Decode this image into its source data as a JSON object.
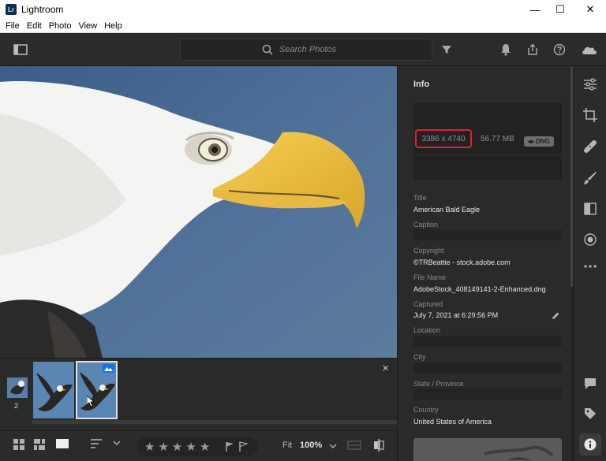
{
  "window": {
    "app_icon_text": "Lr",
    "title": "Lightroom",
    "minimize": "—",
    "maximize": "☐",
    "close": "✕"
  },
  "menu": [
    {
      "label": "File"
    },
    {
      "label": "Edit"
    },
    {
      "label": "Photo"
    },
    {
      "label": "View"
    },
    {
      "label": "Help"
    }
  ],
  "toolbar": {
    "search_placeholder": "Search Photos",
    "icons": [
      "panel-toggle-icon",
      "search-icon",
      "filter-icon",
      "bell-icon",
      "share-icon",
      "help-icon",
      "cloud-icon"
    ]
  },
  "filmstrip": {
    "stack_count": "2",
    "close": "✕"
  },
  "bottombar": {
    "stars": [
      "★",
      "★",
      "★",
      "★",
      "★"
    ],
    "fit_label": "Fit",
    "zoom_value": "100%"
  },
  "info": {
    "heading": "Info",
    "dimensions": "3386 x 4740",
    "file_size": "56.77 MB",
    "format_badge": "DNG",
    "highlight_color": "#e5202e",
    "fields": {
      "title_label": "Title",
      "title_value": "American Bald Eagle",
      "caption_label": "Caption",
      "caption_value": "",
      "copyright_label": "Copyright",
      "copyright_value": "©TRBeattie - stock.adobe.com",
      "filename_label": "File Name",
      "filename_value": "AdobeStock_408149141-2-Enhanced.dng",
      "captured_label": "Captured",
      "captured_value": "July 7, 2021 at 6:29:56 PM",
      "location_label": "Location",
      "city_label": "City",
      "state_label": "State / Province",
      "country_label": "Country",
      "country_value": "United States of America"
    }
  },
  "colors": {
    "background": "#1e1e1e",
    "panel": "#2a2a2a",
    "text": "#e6e6e6",
    "muted": "#8a8a8a",
    "accent": "#1473e6"
  }
}
